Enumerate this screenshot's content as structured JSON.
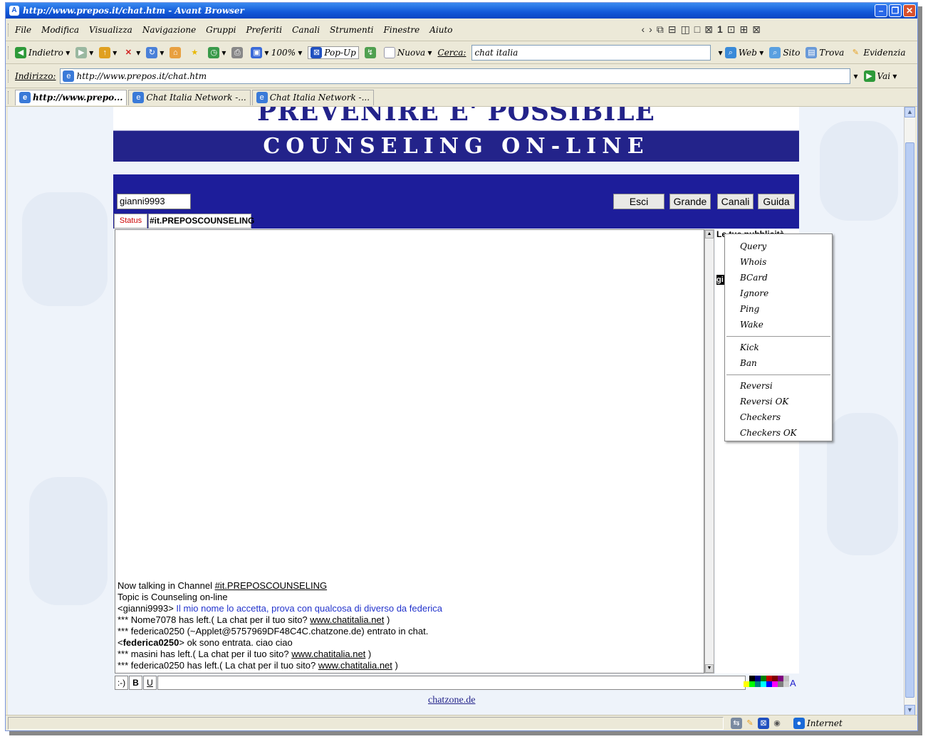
{
  "window": {
    "title": "http://www.prepos.it/chat.htm - Avant Browser",
    "controls": {
      "minimize": "–",
      "maximize": "❐",
      "close": "✕"
    }
  },
  "menu": {
    "items": [
      "File",
      "Modifica",
      "Visualizza",
      "Navigazione",
      "Gruppi",
      "Preferiti",
      "Canali",
      "Strumenti",
      "Finestre",
      "Aiuto"
    ],
    "window_count": "1"
  },
  "toolbar": {
    "back_label": "Indietro",
    "zoom": "100%",
    "popup_label": "Pop-Up",
    "new_label": "Nuova",
    "search_label": "Cerca:",
    "search_value": "chat italia",
    "web_label": "Web",
    "site_label": "Sito",
    "find_label": "Trova",
    "highlight_label": "Evidenzia"
  },
  "address": {
    "label": "Indirizzo:",
    "value": "http://www.prepos.it/chat.htm",
    "go_label": "Vai"
  },
  "tabs": [
    {
      "label": "http://www.prepo..."
    },
    {
      "label": "Chat Italia Network -..."
    },
    {
      "label": "Chat Italia Network -..."
    }
  ],
  "banner": {
    "title": "PREVENIRE E' POSSIBILE",
    "subtitle": "COUNSELING ON-LINE"
  },
  "chat": {
    "nick": "gianni9993",
    "buttons": {
      "quit": "Esci",
      "big": "Grande",
      "channels": "Canali",
      "help": "Guida"
    },
    "status_tab": "Status",
    "channel_tab": "#it.PREPOSCOUNSELING",
    "ads_title": "Le tue pubblicità",
    "user_initial": "gi",
    "log": [
      {
        "prefix": "Now talking in Channel ",
        "link": "#it.PREPOSCOUNSELING",
        "suffix": ""
      },
      {
        "prefix": "Topic is Counseling on-line",
        "link": "",
        "suffix": ""
      },
      {
        "prefix": "<gianni9993> ",
        "blue": "Il mio nome lo accetta, prova con qualcosa di diverso da federica",
        "suffix": ""
      },
      {
        "prefix": "*** Nome7078 has left.( La chat per il tuo sito? ",
        "link": "www.chatitalia.net",
        "suffix": " )"
      },
      {
        "prefix": "*** federica0250 (~Applet@5757969DF48C4C.chatzone.de) entrato in chat.",
        "link": "",
        "suffix": ""
      },
      {
        "prefix": "<",
        "bold": "federica0250",
        "suffix": "> ok sono entrata. ciao ciao"
      },
      {
        "prefix": "*** masini has left.( La chat per il tuo sito? ",
        "link": "www.chatitalia.net",
        "suffix": " )"
      },
      {
        "prefix": "*** federica0250 has left.( La chat per il tuo sito? ",
        "link": "www.chatitalia.net",
        "suffix": " )"
      }
    ],
    "format": {
      "smiley": ":-)",
      "bold": "B",
      "underline": "U"
    },
    "color_letter": "A",
    "footer_link": "chatzone.de"
  },
  "context_menu": {
    "group1": [
      "Query",
      "Whois",
      "BCard",
      "Ignore",
      "Ping",
      "Wake"
    ],
    "group2": [
      "Kick",
      "Ban"
    ],
    "group3": [
      "Reversi",
      "Reversi OK",
      "Checkers",
      "Checkers OK"
    ]
  },
  "status": {
    "zone": "Internet"
  },
  "colors": {
    "banner_blue": "#23238a",
    "panel_blue": "#1d1d9a",
    "link_blue": "#2233cc"
  }
}
